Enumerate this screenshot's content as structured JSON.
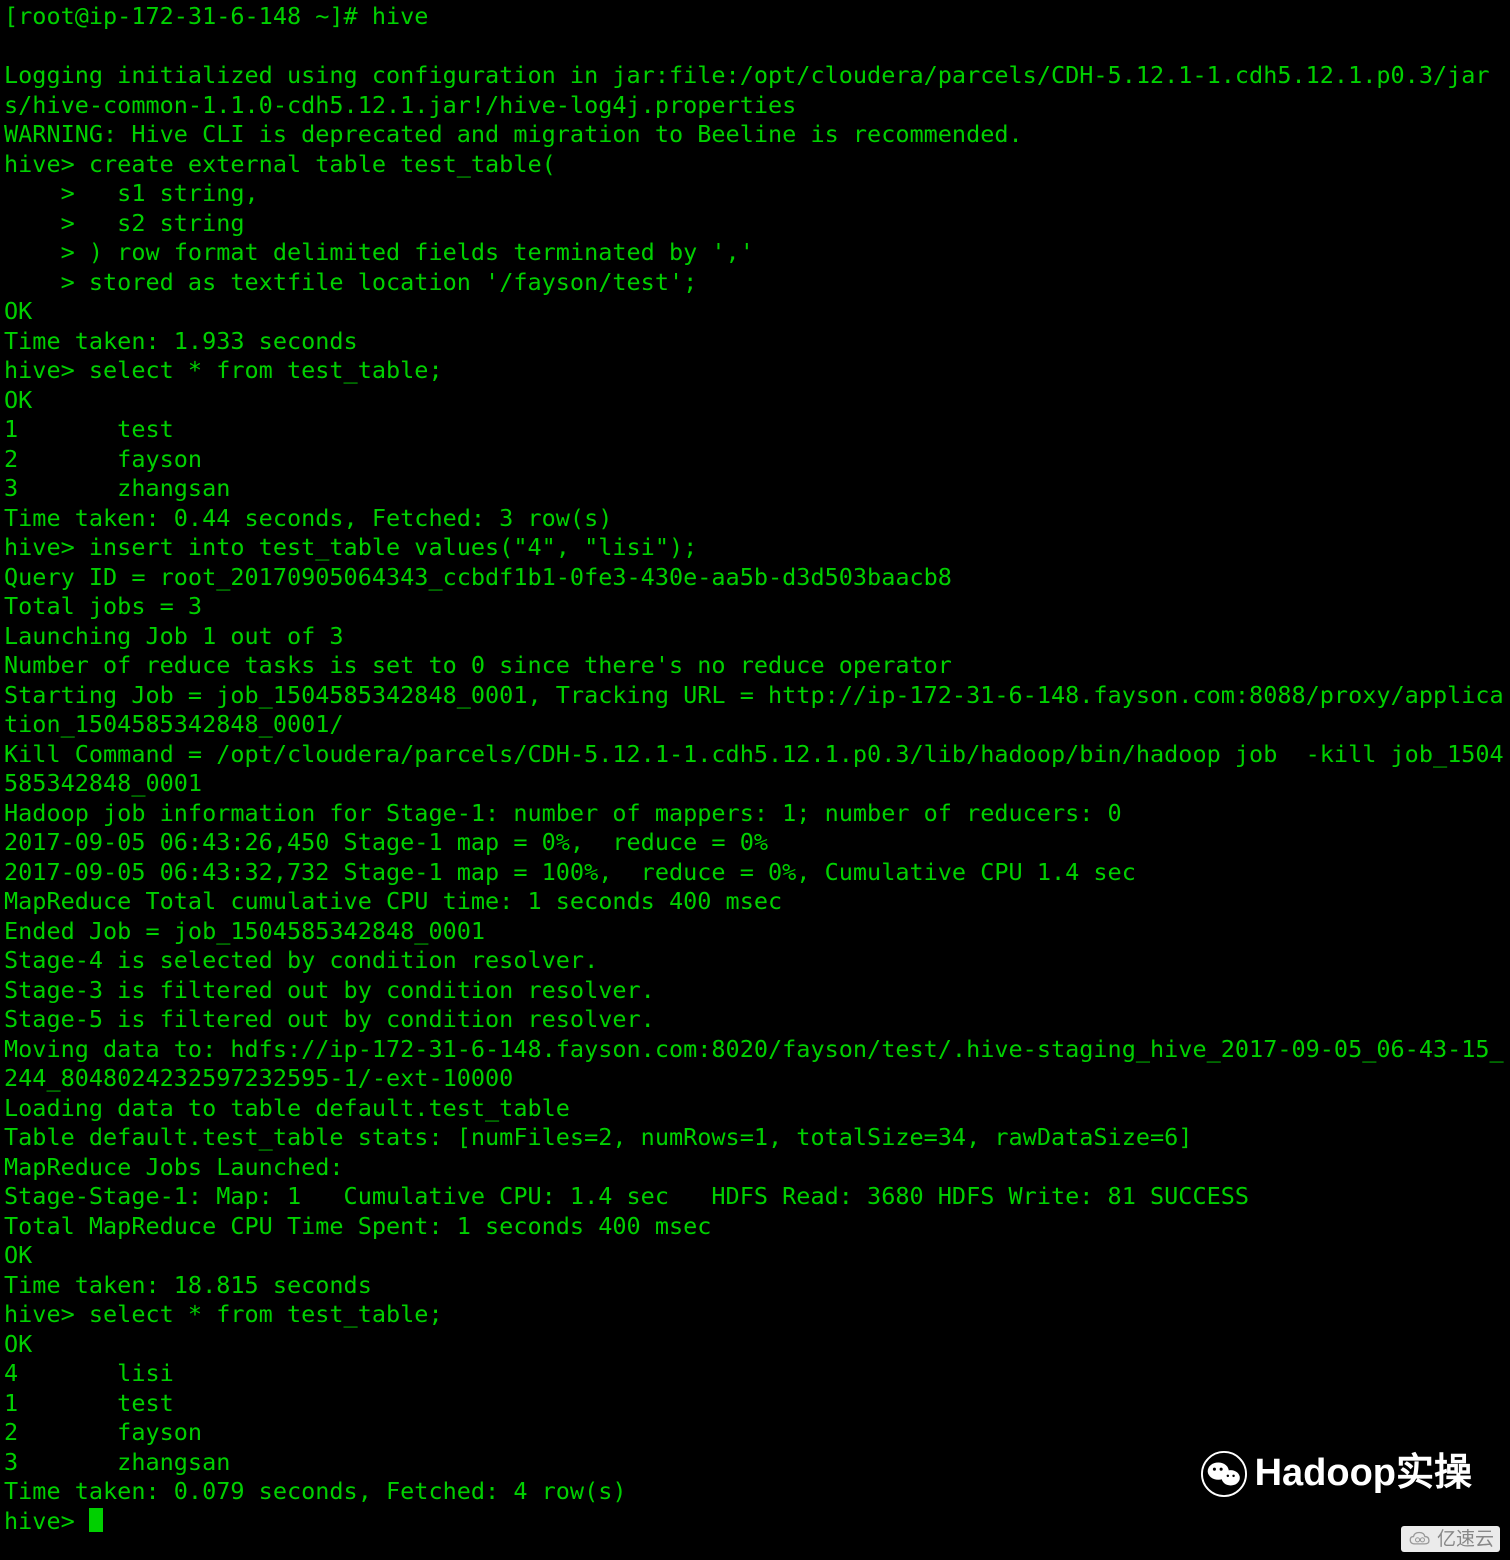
{
  "prompt_line": "[root@ip-172-31-6-148 ~]# hive",
  "log_init": "Logging initialized using configuration in jar:file:/opt/cloudera/parcels/CDH-5.12.1-1.cdh5.12.1.p0.3/jars/hive-common-1.1.0-cdh5.12.1.jar!/hive-log4j.properties",
  "warning": "WARNING: Hive CLI is deprecated and migration to Beeline is recommended.",
  "create_table": {
    "l1": "hive> create external table test_table(",
    "l2": "    >   s1 string,",
    "l3": "    >   s2 string",
    "l4": "    > ) row format delimited fields terminated by ','",
    "l5": "    > stored as textfile location '/fayson/test';"
  },
  "ok1": "OK",
  "tt1": "Time taken: 1.933 seconds",
  "select1": "hive> select * from test_table;",
  "ok2": "OK",
  "rows1": {
    "r1": "1       test",
    "r2": "2       fayson",
    "r3": "3       zhangsan"
  },
  "tt2": "Time taken: 0.44 seconds, Fetched: 3 row(s)",
  "insert": "hive> insert into test_table values(\"4\", \"lisi\");",
  "query_id": "Query ID = root_20170905064343_ccbdf1b1-0fe3-430e-aa5b-d3d503baacb8",
  "total_jobs": "Total jobs = 3",
  "launching": "Launching Job 1 out of 3",
  "reduce_tasks": "Number of reduce tasks is set to 0 since there's no reduce operator",
  "starting_job": "Starting Job = job_1504585342848_0001, Tracking URL = http://ip-172-31-6-148.fayson.com:8088/proxy/application_1504585342848_0001/",
  "kill_cmd": "Kill Command = /opt/cloudera/parcels/CDH-5.12.1-1.cdh5.12.1.p0.3/lib/hadoop/bin/hadoop job  -kill job_1504585342848_0001",
  "job_info": "Hadoop job information for Stage-1: number of mappers: 1; number of reducers: 0",
  "progress1": "2017-09-05 06:43:26,450 Stage-1 map = 0%,  reduce = 0%",
  "progress2": "2017-09-05 06:43:32,732 Stage-1 map = 100%,  reduce = 0%, Cumulative CPU 1.4 sec",
  "mr_total": "MapReduce Total cumulative CPU time: 1 seconds 400 msec",
  "ended": "Ended Job = job_1504585342848_0001",
  "stage4": "Stage-4 is selected by condition resolver.",
  "stage3": "Stage-3 is filtered out by condition resolver.",
  "stage5": "Stage-5 is filtered out by condition resolver.",
  "moving": "Moving data to: hdfs://ip-172-31-6-148.fayson.com:8020/fayson/test/.hive-staging_hive_2017-09-05_06-43-15_244_8048024232597232595-1/-ext-10000",
  "loading": "Loading data to table default.test_table",
  "stats": "Table default.test_table stats: [numFiles=2, numRows=1, totalSize=34, rawDataSize=6]",
  "mr_launched": "MapReduce Jobs Launched:",
  "stage_stage": "Stage-Stage-1: Map: 1   Cumulative CPU: 1.4 sec   HDFS Read: 3680 HDFS Write: 81 SUCCESS",
  "total_mr": "Total MapReduce CPU Time Spent: 1 seconds 400 msec",
  "ok3": "OK",
  "tt3": "Time taken: 18.815 seconds",
  "select2": "hive> select * from test_table;",
  "ok4": "OK",
  "rows2": {
    "r1": "4       lisi",
    "r2": "1       test",
    "r3": "2       fayson",
    "r4": "3       zhangsan"
  },
  "tt4": "Time taken: 0.079 seconds, Fetched: 4 row(s)",
  "final_prompt": "hive> ",
  "watermark1": "Hadoop实操",
  "watermark2": "亿速云"
}
